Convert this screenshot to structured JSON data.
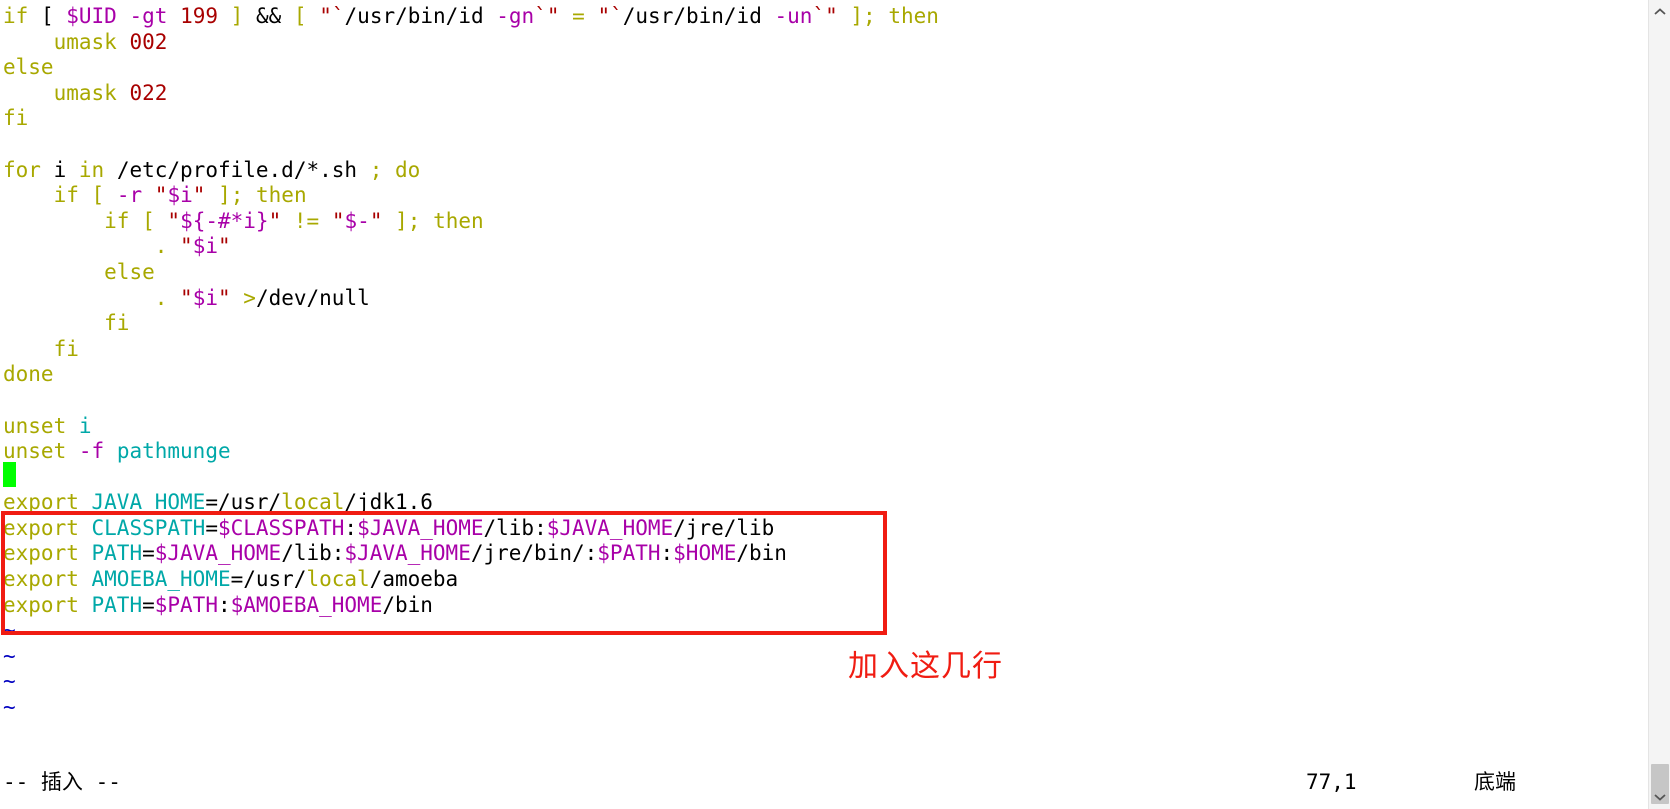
{
  "app": {
    "name": "vim",
    "mode_label": "-- 插入 --",
    "position": "77,1",
    "location_label": "底端"
  },
  "annotation": {
    "text": "加入这几行",
    "color": "#f01c12"
  },
  "colors": {
    "background": "#ffffff",
    "statement": "#a8a800",
    "identifier": "#00a8a8",
    "variable": "#a800a8",
    "constant": "#a80000",
    "normal": "#000000",
    "tilde": "#0000c0",
    "cursor": "#00ff00",
    "highlight_box": "#f01c12",
    "scrollbar_track": "#f4f4f4",
    "scrollbar_thumb": "#c6c6c6"
  },
  "editor": {
    "lines": [
      [
        {
          "t": "if",
          "c": "stmt"
        },
        {
          "t": " [ ",
          "c": "plain"
        },
        {
          "t": "$UID",
          "c": "var"
        },
        {
          "t": " ",
          "c": "plain"
        },
        {
          "t": "-gt",
          "c": "var"
        },
        {
          "t": " ",
          "c": "plain"
        },
        {
          "t": "199",
          "c": "num"
        },
        {
          "t": " ",
          "c": "plain"
        },
        {
          "t": "]",
          "c": "stmt"
        },
        {
          "t": " ",
          "c": "plain"
        },
        {
          "t": "&&",
          "c": "op"
        },
        {
          "t": " ",
          "c": "plain"
        },
        {
          "t": "[",
          "c": "stmt"
        },
        {
          "t": " ",
          "c": "plain"
        },
        {
          "t": "\"`",
          "c": "str"
        },
        {
          "t": "/usr/bin/id",
          "c": "plain"
        },
        {
          "t": " ",
          "c": "plain"
        },
        {
          "t": "-gn",
          "c": "var"
        },
        {
          "t": "`\"",
          "c": "str"
        },
        {
          "t": " ",
          "c": "plain"
        },
        {
          "t": "=",
          "c": "stmt"
        },
        {
          "t": " ",
          "c": "plain"
        },
        {
          "t": "\"`",
          "c": "str"
        },
        {
          "t": "/usr/bin/id",
          "c": "plain"
        },
        {
          "t": " ",
          "c": "plain"
        },
        {
          "t": "-un",
          "c": "var"
        },
        {
          "t": "`\"",
          "c": "str"
        },
        {
          "t": " ",
          "c": "plain"
        },
        {
          "t": "];",
          "c": "stmt"
        },
        {
          "t": " ",
          "c": "plain"
        },
        {
          "t": "then",
          "c": "stmt"
        }
      ],
      [
        {
          "t": "    ",
          "c": "plain"
        },
        {
          "t": "umask",
          "c": "stmt"
        },
        {
          "t": " ",
          "c": "plain"
        },
        {
          "t": "002",
          "c": "num"
        }
      ],
      [
        {
          "t": "else",
          "c": "stmt"
        }
      ],
      [
        {
          "t": "    ",
          "c": "plain"
        },
        {
          "t": "umask",
          "c": "stmt"
        },
        {
          "t": " ",
          "c": "plain"
        },
        {
          "t": "022",
          "c": "num"
        }
      ],
      [
        {
          "t": "fi",
          "c": "stmt"
        }
      ],
      [
        {
          "t": "",
          "c": "plain"
        }
      ],
      [
        {
          "t": "for",
          "c": "stmt"
        },
        {
          "t": " i ",
          "c": "plain"
        },
        {
          "t": "in",
          "c": "stmt"
        },
        {
          "t": " /etc/profile.d/*.sh ",
          "c": "plain"
        },
        {
          "t": ";",
          "c": "stmt"
        },
        {
          "t": " ",
          "c": "plain"
        },
        {
          "t": "do",
          "c": "stmt"
        }
      ],
      [
        {
          "t": "    ",
          "c": "plain"
        },
        {
          "t": "if",
          "c": "stmt"
        },
        {
          "t": " ",
          "c": "plain"
        },
        {
          "t": "[",
          "c": "stmt"
        },
        {
          "t": " ",
          "c": "plain"
        },
        {
          "t": "-r",
          "c": "var"
        },
        {
          "t": " ",
          "c": "plain"
        },
        {
          "t": "\"",
          "c": "str"
        },
        {
          "t": "$i",
          "c": "var"
        },
        {
          "t": "\"",
          "c": "str"
        },
        {
          "t": " ",
          "c": "plain"
        },
        {
          "t": "];",
          "c": "stmt"
        },
        {
          "t": " ",
          "c": "plain"
        },
        {
          "t": "then",
          "c": "stmt"
        }
      ],
      [
        {
          "t": "        ",
          "c": "plain"
        },
        {
          "t": "if",
          "c": "stmt"
        },
        {
          "t": " ",
          "c": "plain"
        },
        {
          "t": "[",
          "c": "stmt"
        },
        {
          "t": " ",
          "c": "plain"
        },
        {
          "t": "\"",
          "c": "str"
        },
        {
          "t": "${-#*i}",
          "c": "var"
        },
        {
          "t": "\"",
          "c": "str"
        },
        {
          "t": " ",
          "c": "plain"
        },
        {
          "t": "!=",
          "c": "stmt"
        },
        {
          "t": " ",
          "c": "plain"
        },
        {
          "t": "\"",
          "c": "str"
        },
        {
          "t": "$-",
          "c": "var"
        },
        {
          "t": "\"",
          "c": "str"
        },
        {
          "t": " ",
          "c": "plain"
        },
        {
          "t": "];",
          "c": "stmt"
        },
        {
          "t": " ",
          "c": "plain"
        },
        {
          "t": "then",
          "c": "stmt"
        }
      ],
      [
        {
          "t": "            ",
          "c": "plain"
        },
        {
          "t": ".",
          "c": "stmt"
        },
        {
          "t": " ",
          "c": "plain"
        },
        {
          "t": "\"",
          "c": "str"
        },
        {
          "t": "$i",
          "c": "var"
        },
        {
          "t": "\"",
          "c": "str"
        }
      ],
      [
        {
          "t": "        ",
          "c": "plain"
        },
        {
          "t": "else",
          "c": "stmt"
        }
      ],
      [
        {
          "t": "            ",
          "c": "plain"
        },
        {
          "t": ".",
          "c": "stmt"
        },
        {
          "t": " ",
          "c": "plain"
        },
        {
          "t": "\"",
          "c": "str"
        },
        {
          "t": "$i",
          "c": "var"
        },
        {
          "t": "\"",
          "c": "str"
        },
        {
          "t": " ",
          "c": "plain"
        },
        {
          "t": ">",
          "c": "stmt"
        },
        {
          "t": "/dev/null",
          "c": "plain"
        }
      ],
      [
        {
          "t": "        ",
          "c": "plain"
        },
        {
          "t": "fi",
          "c": "stmt"
        }
      ],
      [
        {
          "t": "    ",
          "c": "plain"
        },
        {
          "t": "fi",
          "c": "stmt"
        }
      ],
      [
        {
          "t": "done",
          "c": "stmt"
        }
      ],
      [
        {
          "t": "",
          "c": "plain"
        }
      ],
      [
        {
          "t": "unset",
          "c": "stmt"
        },
        {
          "t": " ",
          "c": "plain"
        },
        {
          "t": "i",
          "c": "ident"
        }
      ],
      [
        {
          "t": "unset",
          "c": "stmt"
        },
        {
          "t": " ",
          "c": "plain"
        },
        {
          "t": "-f",
          "c": "var"
        },
        {
          "t": " ",
          "c": "plain"
        },
        {
          "t": "pathmunge",
          "c": "ident"
        }
      ],
      [
        {
          "t": "",
          "c": "plain"
        }
      ],
      [
        {
          "t": "export",
          "c": "stmt"
        },
        {
          "t": " ",
          "c": "plain"
        },
        {
          "t": "JAVA_HOME",
          "c": "ident"
        },
        {
          "t": "=/usr/",
          "c": "plain"
        },
        {
          "t": "local",
          "c": "stmt"
        },
        {
          "t": "/jdk1.6",
          "c": "plain"
        }
      ],
      [
        {
          "t": "export",
          "c": "stmt"
        },
        {
          "t": " ",
          "c": "plain"
        },
        {
          "t": "CLASSPATH",
          "c": "ident"
        },
        {
          "t": "=",
          "c": "plain"
        },
        {
          "t": "$CLASSPATH",
          "c": "var"
        },
        {
          "t": ":",
          "c": "plain"
        },
        {
          "t": "$JAVA_HOME",
          "c": "var"
        },
        {
          "t": "/lib:",
          "c": "plain"
        },
        {
          "t": "$JAVA_HOME",
          "c": "var"
        },
        {
          "t": "/jre/lib",
          "c": "plain"
        }
      ],
      [
        {
          "t": "export",
          "c": "stmt"
        },
        {
          "t": " ",
          "c": "plain"
        },
        {
          "t": "PATH",
          "c": "ident"
        },
        {
          "t": "=",
          "c": "plain"
        },
        {
          "t": "$JAVA_HOME",
          "c": "var"
        },
        {
          "t": "/lib:",
          "c": "plain"
        },
        {
          "t": "$JAVA_HOME",
          "c": "var"
        },
        {
          "t": "/jre/bin/:",
          "c": "plain"
        },
        {
          "t": "$PATH",
          "c": "var"
        },
        {
          "t": ":",
          "c": "plain"
        },
        {
          "t": "$HOME",
          "c": "var"
        },
        {
          "t": "/bin",
          "c": "plain"
        }
      ],
      [
        {
          "t": "export",
          "c": "stmt"
        },
        {
          "t": " ",
          "c": "plain"
        },
        {
          "t": "AMOEBA_HOME",
          "c": "ident"
        },
        {
          "t": "=/usr/",
          "c": "plain"
        },
        {
          "t": "local",
          "c": "stmt"
        },
        {
          "t": "/amoeba",
          "c": "plain"
        }
      ],
      [
        {
          "t": "export",
          "c": "stmt"
        },
        {
          "t": " ",
          "c": "plain"
        },
        {
          "t": "PATH",
          "c": "ident"
        },
        {
          "t": "=",
          "c": "plain"
        },
        {
          "t": "$PATH",
          "c": "var"
        },
        {
          "t": ":",
          "c": "plain"
        },
        {
          "t": "$AMOEBA_HOME",
          "c": "var"
        },
        {
          "t": "/bin",
          "c": "plain"
        }
      ],
      [
        {
          "t": "~",
          "c": "tilde"
        }
      ],
      [
        {
          "t": "~",
          "c": "tilde"
        }
      ],
      [
        {
          "t": "~",
          "c": "tilde"
        }
      ],
      [
        {
          "t": "~",
          "c": "tilde"
        }
      ]
    ]
  },
  "scrollbar": {
    "up_arrow": "chevron-up-icon",
    "down_arrow": "chevron-down-icon"
  }
}
